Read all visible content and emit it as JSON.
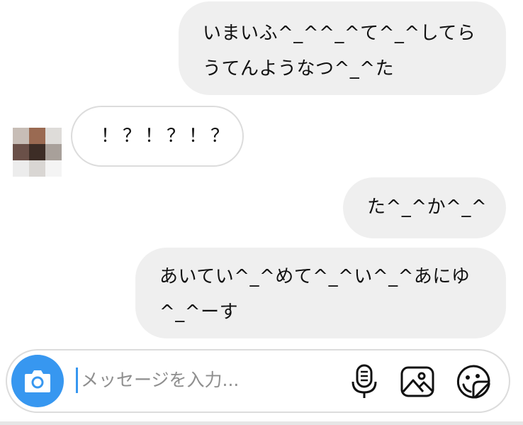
{
  "conversation": {
    "messages": [
      {
        "sender": "me",
        "text": "いまいふ^_^^_^て^_^してら\nうてんようなつ^_^た"
      },
      {
        "sender": "other",
        "text": "！？！？！？"
      },
      {
        "sender": "me",
        "text": "た^_^か^_^"
      },
      {
        "sender": "me",
        "text": "あいてい^_^めて^_^い^_^あにゆ\n^_^ーす"
      }
    ]
  },
  "composer": {
    "placeholder": "メッセージを入力...",
    "camera_icon": "camera-icon",
    "mic_icon": "microphone-icon",
    "gallery_icon": "image-icon",
    "sticker_icon": "sticker-icon",
    "accent_color": "#3797f0"
  },
  "colors": {
    "sent_bubble": "#efefef",
    "received_border": "#dcdcdc",
    "text": "#111111"
  }
}
